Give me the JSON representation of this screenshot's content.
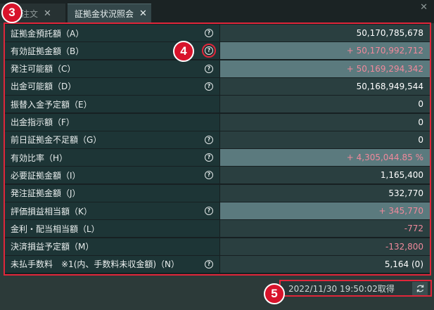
{
  "tabs": [
    {
      "label": "注文",
      "close": "✕",
      "active": false
    },
    {
      "label": "証拠金状況照会",
      "close": "✕",
      "active": true
    }
  ],
  "window_close": "✕",
  "rows": [
    {
      "label": "証拠金預託額（A）",
      "value": "50,170,785,678",
      "help": true,
      "style": "normal"
    },
    {
      "label": "有効証拠金額（B）",
      "value": "+ 50,170,992,712",
      "help": true,
      "style": "highlight"
    },
    {
      "label": "発注可能額（C）",
      "value": "+ 50,169,294,342",
      "help": true,
      "style": "highlight"
    },
    {
      "label": "出金可能額（D）",
      "value": "50,168,949,544",
      "help": true,
      "style": "normal"
    },
    {
      "label": "振替入金予定額（E）",
      "value": "0",
      "help": false,
      "style": "normal"
    },
    {
      "label": "出金指示額（F）",
      "value": "0",
      "help": false,
      "style": "normal"
    },
    {
      "label": "前日証拠金不足額（G）",
      "value": "0",
      "help": true,
      "style": "normal"
    },
    {
      "label": "有効比率（H）",
      "value": "+ 4,305,044.85 %",
      "help": true,
      "style": "highlight"
    },
    {
      "label": "必要証拠金額（I）",
      "value": "1,165,400",
      "help": true,
      "style": "normal"
    },
    {
      "label": "発注証拠金額（J）",
      "value": "532,770",
      "help": false,
      "style": "normal"
    },
    {
      "label": "評価損益相当額（K）",
      "value": "+ 345,770",
      "help": true,
      "style": "highlight"
    },
    {
      "label": "金利・配当相当額（L）",
      "value": "-772",
      "help": false,
      "style": "negative"
    },
    {
      "label": "決済損益予定額（M）",
      "value": "-132,800",
      "help": false,
      "style": "negative"
    },
    {
      "label": "未払手数料　※1(内、手数料未収金額)（N）",
      "value": "5,164 (0)",
      "help": true,
      "style": "normal"
    }
  ],
  "help_glyph": "?",
  "footer": {
    "timestamp": "2022/11/30 19:50:02取得"
  },
  "callouts": [
    "3",
    "4",
    "5"
  ],
  "colors": {
    "accent_red": "#e0263a",
    "positive_value": "#f0899b",
    "highlight_bg": "#5b7a7e"
  }
}
